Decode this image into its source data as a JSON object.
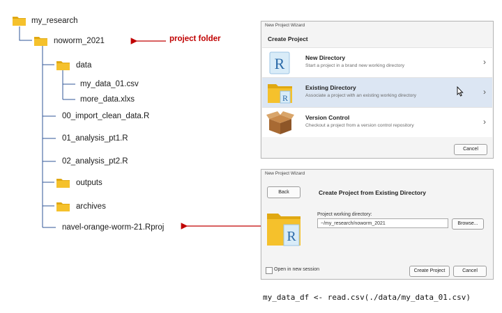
{
  "tree": {
    "items": [
      {
        "label": "my_research",
        "kind": "folder"
      },
      {
        "label": "noworm_2021",
        "kind": "folder"
      },
      {
        "label": "data",
        "kind": "folder"
      },
      {
        "label": "my_data_01.csv",
        "kind": "file"
      },
      {
        "label": "more_data.xlxs",
        "kind": "file"
      },
      {
        "label": "00_import_clean_data.R",
        "kind": "file"
      },
      {
        "label": "01_analysis_pt1.R",
        "kind": "file"
      },
      {
        "label": "02_analysis_pt2.R",
        "kind": "file"
      },
      {
        "label": "outputs",
        "kind": "folder"
      },
      {
        "label": "archives",
        "kind": "folder"
      },
      {
        "label": "navel-orange-worm-21.Rproj",
        "kind": "file"
      }
    ]
  },
  "annotations": {
    "project_folder": "project folder"
  },
  "wizard1": {
    "window_title": "New Project Wizard",
    "heading": "Create Project",
    "options": [
      {
        "title": "New Directory",
        "subtitle": "Start a project in a brand new working directory",
        "icon": "r-document-icon",
        "selected": false
      },
      {
        "title": "Existing Directory",
        "subtitle": "Associate a project with an existing working directory",
        "icon": "folder-icon",
        "selected": true
      },
      {
        "title": "Version Control",
        "subtitle": "Checkout a project from a version control repository",
        "icon": "package-box-icon",
        "selected": false
      }
    ],
    "cancel_label": "Cancel"
  },
  "wizard2": {
    "window_title": "New Project Wizard",
    "back_label": "Back",
    "heading": "Create Project from Existing Directory",
    "field_label": "Project working directory:",
    "field_value": "~/my_research/noworm_2021",
    "browse_label": "Browse...",
    "checkbox_label": "Open in new session",
    "checkbox_checked": false,
    "create_label": "Create Project",
    "cancel_label": "Cancel"
  },
  "code_line": "my_data_df <- read.csv(./data/my_data_01.csv)",
  "colors": {
    "folder": "#f5c12c",
    "tree_line": "#2f5597",
    "arrow": "#c00000",
    "selected_row": "#dce6f3"
  }
}
